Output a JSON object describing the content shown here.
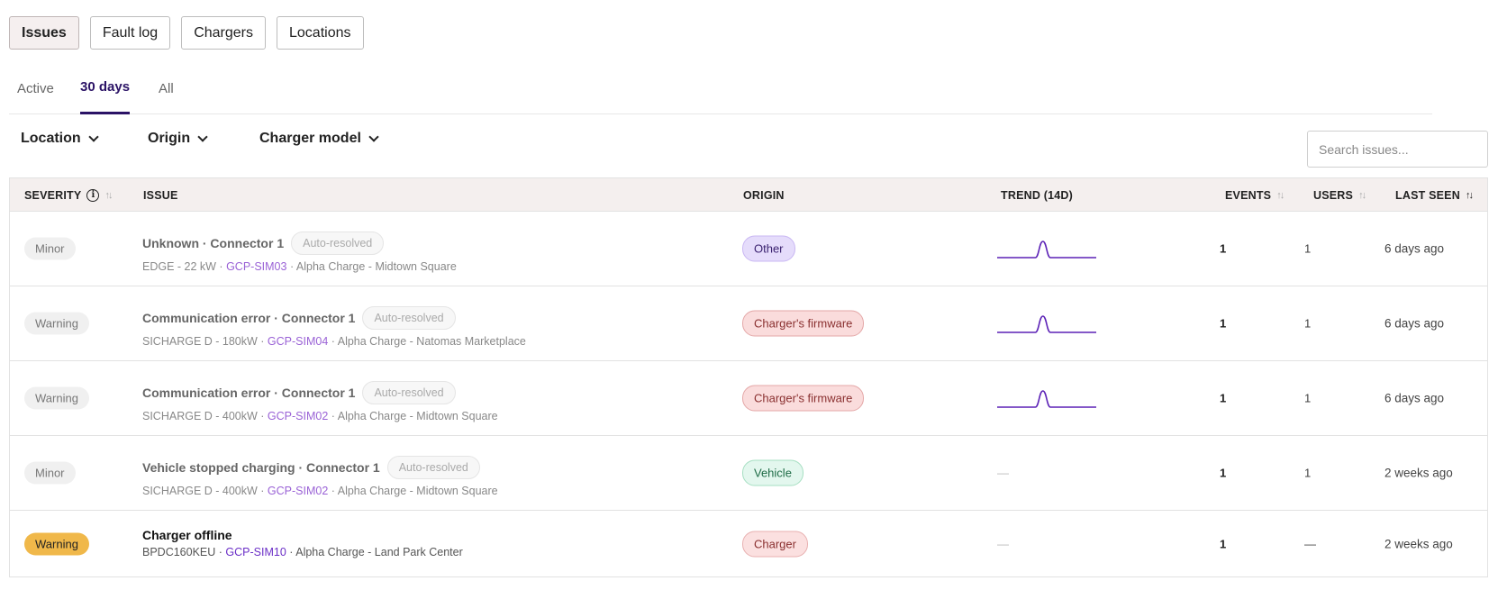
{
  "top_tabs": [
    "Issues",
    "Fault log",
    "Chargers",
    "Locations"
  ],
  "sub_tabs": [
    "Active",
    "30 days",
    "All"
  ],
  "filters": {
    "location": "Location",
    "origin": "Origin",
    "charger_model": "Charger model"
  },
  "search": {
    "placeholder": "Search issues..."
  },
  "headers": {
    "severity": "SEVERITY",
    "issue": "ISSUE",
    "origin": "ORIGIN",
    "trend": "TREND (14D)",
    "events": "EVENTS",
    "users": "USERS",
    "last_seen": "LAST SEEN"
  },
  "rows": [
    {
      "severity": "Minor",
      "title": "Unknown · Connector 1",
      "auto": "Auto-resolved",
      "model": "EDGE - 22 kW ·",
      "sim": "GCP-SIM03",
      "place": "· Alpha Charge - Midtown Square",
      "origin": "Other",
      "trend_values": [
        0,
        0,
        0,
        0,
        0,
        0,
        1,
        0,
        0,
        0,
        0,
        0,
        0,
        0
      ],
      "events": "1",
      "users": "1",
      "last_seen": "6 days ago"
    },
    {
      "severity": "Warning",
      "title": "Communication error · Connector 1",
      "auto": "Auto-resolved",
      "model": "SICHARGE D - 180kW ·",
      "sim": "GCP-SIM04",
      "place": "· Alpha Charge - Natomas Marketplace",
      "origin": "Charger's firmware",
      "trend_values": [
        0,
        0,
        0,
        0,
        0,
        0,
        1,
        0,
        0,
        0,
        0,
        0,
        0,
        0
      ],
      "events": "1",
      "users": "1",
      "last_seen": "6 days ago"
    },
    {
      "severity": "Warning",
      "title": "Communication error · Connector 1",
      "auto": "Auto-resolved",
      "model": "SICHARGE D - 400kW ·",
      "sim": "GCP-SIM02",
      "place": "· Alpha Charge - Midtown Square",
      "origin": "Charger's firmware",
      "trend_values": [
        0,
        0,
        0,
        0,
        0,
        0,
        1,
        0,
        0,
        0,
        0,
        0,
        0,
        0
      ],
      "events": "1",
      "users": "1",
      "last_seen": "6 days ago"
    },
    {
      "severity": "Minor",
      "title": "Vehicle stopped charging · Connector 1",
      "auto": "Auto-resolved",
      "model": "SICHARGE D - 400kW ·",
      "sim": "GCP-SIM02",
      "place": "· Alpha Charge - Midtown Square",
      "origin": "Vehicle",
      "trend_text": "—",
      "events": "1",
      "users": "1",
      "last_seen": "2 weeks ago"
    },
    {
      "severity": "Warning",
      "title": "Charger offline",
      "model": "BPDC160KEU ·",
      "sim": "GCP-SIM10",
      "place": "· Alpha Charge - Land Park Center",
      "origin": "Charger",
      "trend_text": "—",
      "events": "1",
      "users": "—",
      "last_seen": "2 weeks ago"
    }
  ],
  "colors": {
    "accent": "#2b1366",
    "trend_line": "#5b21b6",
    "warning_strong": "#f0b84a"
  }
}
